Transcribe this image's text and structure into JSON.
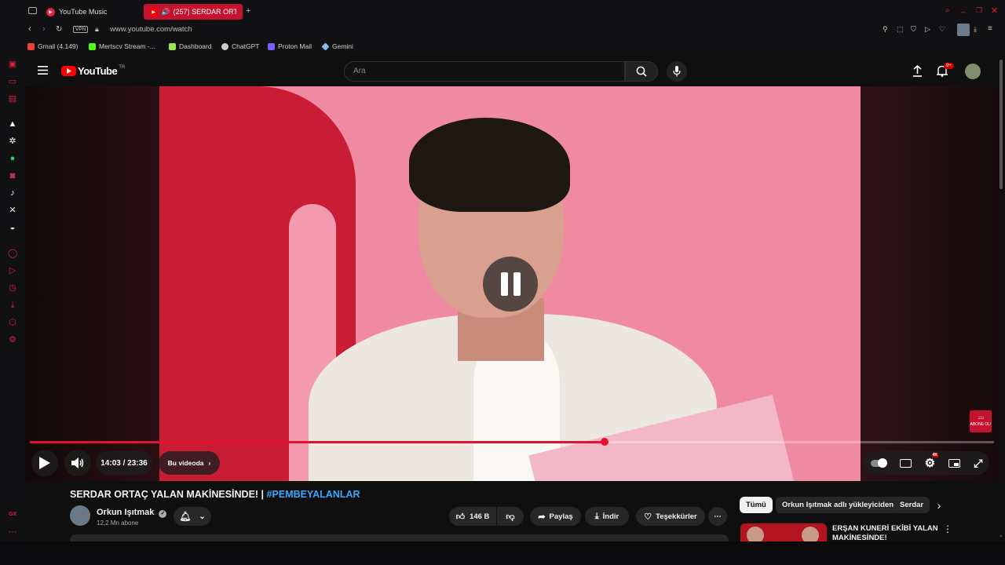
{
  "browser": {
    "tabs": [
      {
        "label": "YouTube Music"
      },
      {
        "label": "(257) SERDAR ORTAÇ"
      }
    ],
    "url": "www.youtube.com/watch",
    "vpn_label": "VPN",
    "bookmarks": [
      {
        "label": "Gmail (4.149)",
        "color": "#ea4335"
      },
      {
        "label": "Mertscv Stream -...",
        "color": "#53fc18"
      },
      {
        "label": "Dashboard",
        "color": "#9be34a"
      },
      {
        "label": "ChatGPT",
        "color": "#cccccc"
      },
      {
        "label": "Proton Mail",
        "color": "#7b5cff"
      },
      {
        "label": "Gemini",
        "color": "#8ab4f8"
      }
    ],
    "sidebar_bottom_label": "GX"
  },
  "youtube": {
    "logo_text": "YouTube",
    "region": "TR",
    "search_placeholder": "Ara",
    "notifications_badge": "9+"
  },
  "player": {
    "time": "14:03 / 23:36",
    "chapter_label": "Bu videoda",
    "progress": 0.596,
    "badge_text": "ABONE OL!",
    "hd_badge": "4K"
  },
  "video": {
    "title": "SERDAR ORTAÇ YALAN MAKİNESİNDE! |",
    "hashtag": "#PEMBEYALANLAR",
    "channel_name": "Orkun Işıtmak",
    "subscribers": "12,2 Mn abone",
    "likes": "146 B",
    "share_label": "Paylaş",
    "download_label": "İndir",
    "thanks_label": "Teşekkürler"
  },
  "recommendations": {
    "chips": [
      "Tümü",
      "Orkun Işıtmak adlı yükleyiciden",
      "Serdar"
    ],
    "first_title": "ERŞAN KUNERİ EKİBİ YALAN MAKİNESİNDE!"
  },
  "colors": {
    "accent": "#e3122c",
    "brand_red": "#ff0000",
    "link_blue": "#3ea6ff"
  }
}
